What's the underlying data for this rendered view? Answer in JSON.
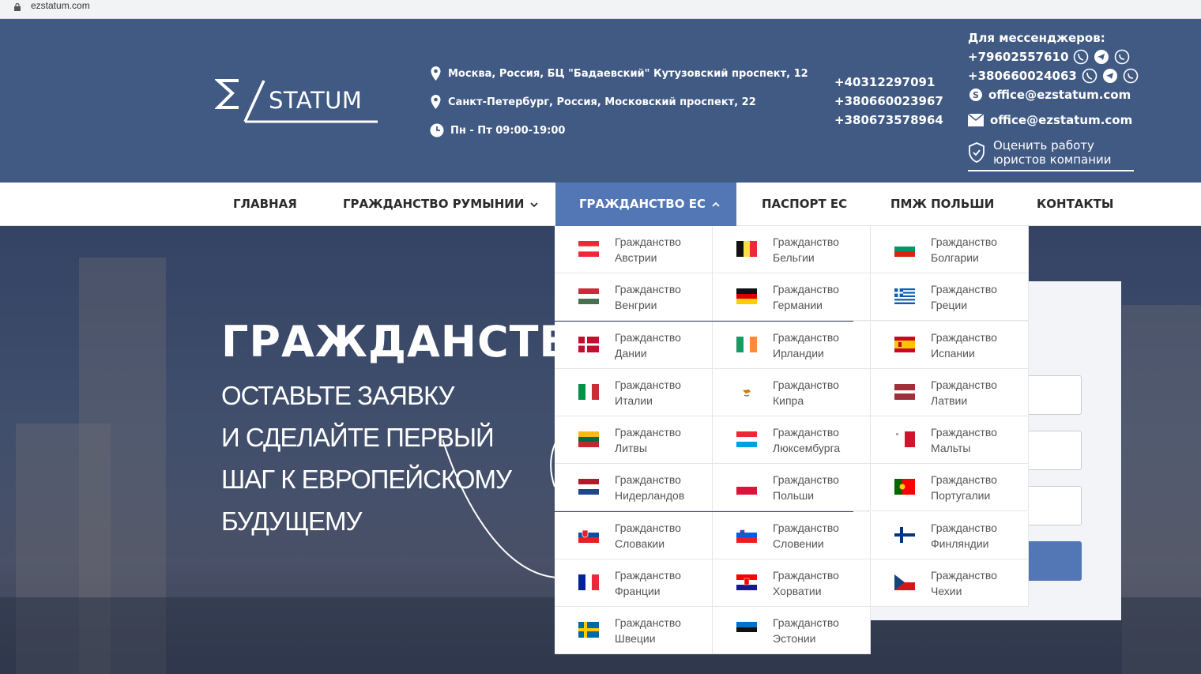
{
  "browser": {
    "url": "ezstatum.com"
  },
  "header": {
    "logo_text": "STATUM",
    "address_moscow": "Москва, Россия, БЦ \"Бадаевский\" Кутузовский проспект, 12",
    "address_spb": "Санкт-Петербург, Россия, Московский проспект, 22",
    "hours": "Пн - Пт 09:00-19:00",
    "phones": [
      "+40312297091",
      "+380660023967",
      "+380673578964"
    ],
    "messengers_title": "Для мессенджеров:",
    "messenger_phones": [
      "+79602557610",
      "+380660024063"
    ],
    "skype_email": "office@ezstatum.com",
    "email": "office@ezstatum.com",
    "rate_line1": "Оценить работу",
    "rate_line2": "юристов компании"
  },
  "nav": {
    "items": [
      {
        "label": "ГЛАВНАЯ"
      },
      {
        "label": "ГРАЖДАНСТВО РУМЫНИИ"
      },
      {
        "label": "ГРАЖДАНСТВО ЕС"
      },
      {
        "label": "ПАСПОРТ ЕС"
      },
      {
        "label": "ПМЖ ПОЛЬШИ"
      },
      {
        "label": "КОНТАКТЫ"
      }
    ]
  },
  "hero": {
    "title": "ГРАЖДАНСТВО",
    "sub": [
      "ОСТАВЬТЕ ЗАЯВКУ",
      "И СДЕЛАЙТЕ ПЕРВЫЙ",
      "ШАГ К ЕВРОПЕЙСКОМУ",
      "БУДУЩЕМУ"
    ]
  },
  "dropdown": {
    "prefix": "Гражданство",
    "items": [
      {
        "country": "Австрии",
        "flag": "austria"
      },
      {
        "country": "Бельгии",
        "flag": "belgium"
      },
      {
        "country": "Болгарии",
        "flag": "bulgaria"
      },
      {
        "country": "Венгрии",
        "flag": "hungary"
      },
      {
        "country": "Германии",
        "flag": "germany"
      },
      {
        "country": "Греции",
        "flag": "greece"
      },
      {
        "country": "Дании",
        "flag": "denmark"
      },
      {
        "country": "Ирландии",
        "flag": "ireland"
      },
      {
        "country": "Испании",
        "flag": "spain"
      },
      {
        "country": "Италии",
        "flag": "italy"
      },
      {
        "country": "Кипра",
        "flag": "cyprus"
      },
      {
        "country": "Латвии",
        "flag": "latvia"
      },
      {
        "country": "Литвы",
        "flag": "lithuania"
      },
      {
        "country": "Люксембурга",
        "flag": "luxembourg"
      },
      {
        "country": "Мальты",
        "flag": "malta"
      },
      {
        "country": "Нидерландов",
        "flag": "netherlands"
      },
      {
        "country": "Польши",
        "flag": "poland"
      },
      {
        "country": "Португалии",
        "flag": "portugal"
      },
      {
        "country": "Словакии",
        "flag": "slovakia"
      },
      {
        "country": "Словении",
        "flag": "slovenia"
      },
      {
        "country": "Финляндии",
        "flag": "finland"
      },
      {
        "country": "Франции",
        "flag": "france"
      },
      {
        "country": "Хорватии",
        "flag": "croatia"
      },
      {
        "country": "Чехии",
        "flag": "czech"
      },
      {
        "country": "Швеции",
        "flag": "sweden"
      },
      {
        "country": "Эстонии",
        "flag": "estonia"
      }
    ]
  },
  "colors": {
    "header_bg": "#415a84",
    "accent": "#5377b4"
  }
}
